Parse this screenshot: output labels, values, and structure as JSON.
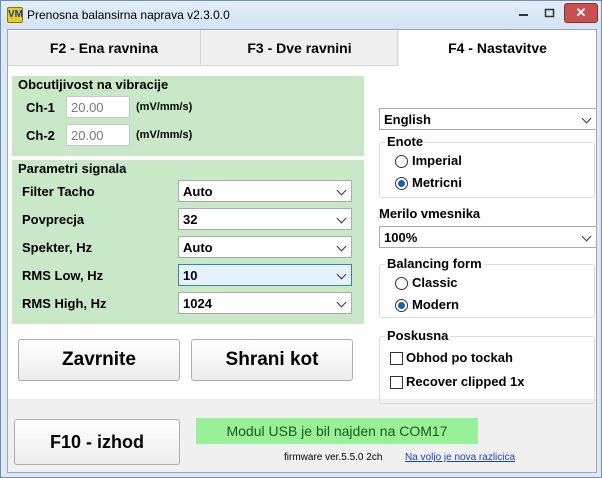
{
  "window": {
    "title": "Prenosna balansirna naprava v2.3.0.0",
    "icon_text": "VM",
    "min_icon": "minimize-icon",
    "max_icon": "maximize-icon",
    "close_icon": "close-icon",
    "close_glyph": "✕"
  },
  "tabs": [
    {
      "label": "F2 - Ena ravnina"
    },
    {
      "label": "F3 - Dve ravnini"
    },
    {
      "label": "F4 - Nastavitve",
      "active": true
    }
  ],
  "sensitivity": {
    "title": "Obcutljivost na vibracije",
    "channels": [
      {
        "label": "Ch-1",
        "value": "20.00",
        "unit": "(mV/mm/s)"
      },
      {
        "label": "Ch-2",
        "value": "20.00",
        "unit": "(mV/mm/s)"
      }
    ]
  },
  "signal": {
    "title": "Parametri signala",
    "rows": [
      {
        "label": "Filter Tacho",
        "value": "Auto"
      },
      {
        "label": "Povprecja",
        "value": "32"
      },
      {
        "label": "Spekter, Hz",
        "value": "Auto"
      },
      {
        "label": "RMS Low, Hz",
        "value": "10"
      },
      {
        "label": "RMS High, Hz",
        "value": "1024"
      }
    ]
  },
  "buttons": {
    "cancel": "Zavrnite",
    "save": "Shrani kot",
    "exit": "F10 - izhod"
  },
  "language": {
    "value": "English"
  },
  "units_group": {
    "title": "Enote",
    "options": [
      {
        "label": "Imperial",
        "selected": false
      },
      {
        "label": "Metricni",
        "selected": true
      }
    ]
  },
  "gauge_scale": {
    "title": "Merilo vmesnika",
    "value": "100%"
  },
  "balancing_form": {
    "title": "Balancing form",
    "options": [
      {
        "label": "Classic",
        "selected": false
      },
      {
        "label": "Modern",
        "selected": true
      }
    ]
  },
  "experimental": {
    "title": "Poskusna",
    "options": [
      {
        "label": "Obhod po tockah",
        "checked": false
      },
      {
        "label": "Recover clipped 1x",
        "checked": false
      }
    ]
  },
  "status": {
    "message": "Modul USB je bil najden na COM17",
    "firmware": "firmware ver.5.5.0 2ch",
    "update_link": "Na voljo je nova razlicica"
  },
  "colors": {
    "green_panel": "#c8e8c8",
    "status_bg": "#98f098",
    "close_button": "#c75050",
    "link": "#1a3fc4"
  }
}
